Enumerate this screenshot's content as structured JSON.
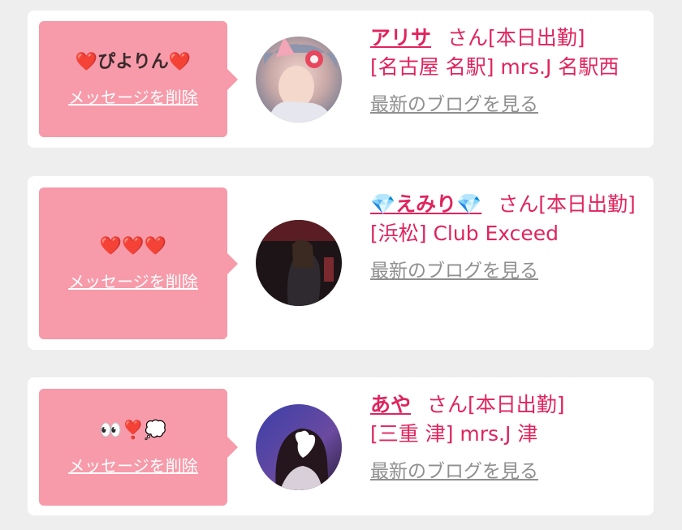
{
  "messages": [
    {
      "text": "❤️ぴよりん❤️",
      "delete_label": "メッセージを削除",
      "name": "アリサ",
      "suffix": "さん",
      "status": "[本日出勤]",
      "location": "[名古屋 名駅] mrs.J 名駅西",
      "blog_label": "最新のブログを見る"
    },
    {
      "text": "❤️❤️❤️",
      "delete_label": "メッセージを削除",
      "name": "💎えみり💎",
      "suffix": "さん",
      "status": "[本日出勤]",
      "location": "[浜松] Club Exceed",
      "blog_label": "最新のブログを見る"
    },
    {
      "text": "👀❣️💭",
      "delete_label": "メッセージを削除",
      "name": "あや",
      "suffix": "さん",
      "status": "[本日出勤]",
      "location": "[三重 津] mrs.J 津",
      "blog_label": "最新のブログを見る"
    }
  ],
  "colors": {
    "page_background": "#eeeeee",
    "bubble": "#f79aa9",
    "accent_pink": "#e0245e",
    "link_gray": "#8f8f8f"
  }
}
